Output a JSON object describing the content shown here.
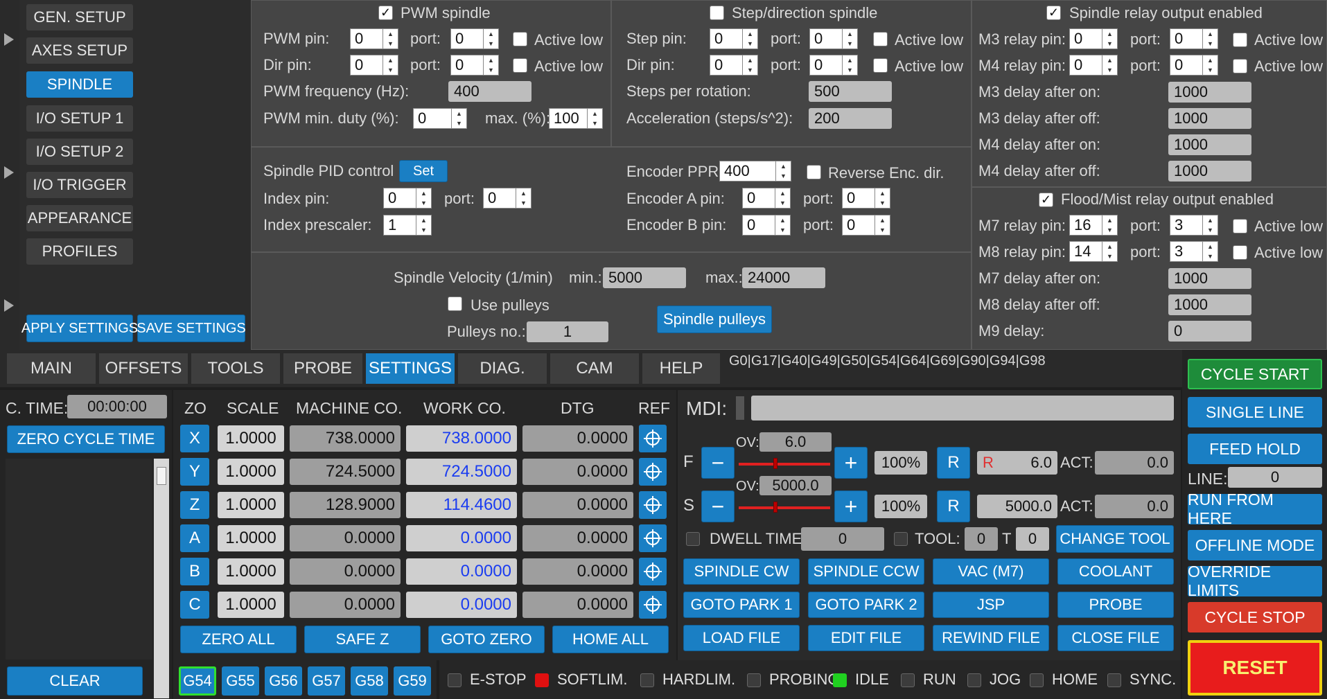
{
  "left_nav": {
    "items": [
      {
        "label": "GEN. SETUP",
        "active": false
      },
      {
        "label": "AXES SETUP",
        "active": false
      },
      {
        "label": "SPINDLE",
        "active": true
      },
      {
        "label": "I/O SETUP 1",
        "active": false
      },
      {
        "label": "I/O SETUP 2",
        "active": false
      },
      {
        "label": "I/O TRIGGER",
        "active": false
      },
      {
        "label": "APPEARANCE",
        "active": false
      },
      {
        "label": "PROFILES",
        "active": false
      }
    ],
    "apply_label": "APPLY SETTINGS",
    "save_label": "SAVE SETTINGS"
  },
  "pwm": {
    "title": "PWM spindle",
    "checked": true,
    "pwm_pin_label": "PWM pin:",
    "pwm_pin": "0",
    "port_label": "port:",
    "pwm_port": "0",
    "active_low": "Active low",
    "dir_pin_label": "Dir pin:",
    "dir_pin": "0",
    "dir_port": "0",
    "freq_label": "PWM frequency (Hz):",
    "freq": "400",
    "min_duty_label": "PWM min. duty (%):",
    "min_duty": "0",
    "max_label": "max. (%):",
    "max_duty": "100"
  },
  "step": {
    "title": "Step/direction spindle",
    "checked": false,
    "step_pin_label": "Step pin:",
    "step_pin": "0",
    "step_port": "0",
    "dir_pin_label": "Dir pin:",
    "dir_pin": "0",
    "dir_port": "0",
    "steps_label": "Steps per rotation:",
    "steps": "500",
    "accel_label": "Acceleration (steps/s^2):",
    "accel": "200"
  },
  "pid": {
    "label": "Spindle PID control",
    "set_label": "Set",
    "index_pin_label": "Index pin:",
    "index_pin": "0",
    "index_port": "0",
    "prescaler_label": "Index prescaler:",
    "prescaler": "1",
    "ppr_label": "Encoder PPR:",
    "ppr": "400",
    "reverse_label": "Reverse Enc. dir.",
    "enc_a_label": "Encoder A pin:",
    "enc_a_pin": "0",
    "enc_a_port": "0",
    "enc_b_label": "Encoder B pin:",
    "enc_b_pin": "0",
    "enc_b_port": "0"
  },
  "velocity": {
    "label": "Spindle Velocity (1/min)",
    "min_label": "min.:",
    "min": "5000",
    "max_label": "max.:",
    "max": "24000",
    "pulleys_label": "Use pulleys",
    "pulleys_no_label": "Pulleys no.:",
    "pulleys_no": "1",
    "pulleys_button": "Spindle pulleys"
  },
  "relay": {
    "title": "Spindle relay output enabled",
    "m3_pin_label": "M3 relay pin:",
    "m3_pin": "0",
    "m3_port": "0",
    "m4_pin_label": "M4 relay pin:",
    "m4_pin": "0",
    "m4_port": "0",
    "m3_on_label": "M3 delay after on:",
    "m3_on": "1000",
    "m3_off_label": "M3 delay after off:",
    "m3_off": "1000",
    "m4_on_label": "M4 delay after on:",
    "m4_on": "1000",
    "m4_off_label": "M4 delay after off:",
    "m4_off": "1000"
  },
  "flood": {
    "title": "Flood/Mist relay output enabled",
    "m7_pin_label": "M7 relay pin:",
    "m7_pin": "16",
    "m7_port": "3",
    "m8_pin_label": "M8 relay pin:",
    "m8_pin": "14",
    "m8_port": "3",
    "m7_on_label": "M7 delay after on:",
    "m7_on": "1000",
    "m8_off_label": "M8 delay after off:",
    "m8_off": "1000",
    "m9_label": "M9 delay:",
    "m9": "0"
  },
  "tabs": [
    "MAIN",
    "OFFSETS",
    "TOOLS",
    "PROBE",
    "SETTINGS",
    "DIAG.",
    "CAM",
    "HELP"
  ],
  "gcode_status": "G0|G17|G40|G49|G50|G54|G64|G69|G90|G94|G98",
  "cycle_time": {
    "label": "C. TIME:",
    "value": "00:00:00",
    "zero_label": "ZERO CYCLE TIME",
    "clear_label": "CLEAR"
  },
  "dro": {
    "headers": [
      "ZO",
      "SCALE",
      "MACHINE CO.",
      "WORK CO.",
      "DTG",
      "REF"
    ],
    "axes": [
      {
        "name": "X",
        "scale": "1.0000",
        "machine": "738.0000",
        "work": "738.0000",
        "dtg": "0.0000"
      },
      {
        "name": "Y",
        "scale": "1.0000",
        "machine": "724.5000",
        "work": "724.5000",
        "dtg": "0.0000"
      },
      {
        "name": "Z",
        "scale": "1.0000",
        "machine": "128.9000",
        "work": "114.4600",
        "dtg": "0.0000"
      },
      {
        "name": "A",
        "scale": "1.0000",
        "machine": "0.0000",
        "work": "0.0000",
        "dtg": "0.0000"
      },
      {
        "name": "B",
        "scale": "1.0000",
        "machine": "0.0000",
        "work": "0.0000",
        "dtg": "0.0000"
      },
      {
        "name": "C",
        "scale": "1.0000",
        "machine": "0.0000",
        "work": "0.0000",
        "dtg": "0.0000"
      }
    ],
    "zero_all": "ZERO ALL",
    "safe_z": "SAFE Z",
    "goto_zero": "GOTO ZERO",
    "home_all": "HOME ALL"
  },
  "wcs": [
    "G54",
    "G55",
    "G56",
    "G57",
    "G58",
    "G59"
  ],
  "mdi_label": "MDI:",
  "feed": {
    "label": "F",
    "ov_label": "OV:",
    "ov": "6.0",
    "percent": "100%",
    "r_label": "R",
    "value_prefix": "R",
    "value": "6.0",
    "act_label": "ACT:",
    "act": "0.0",
    "override_fraction": 0.4
  },
  "speed": {
    "label": "S",
    "ov_label": "OV:",
    "ov": "5000.0",
    "percent": "100%",
    "r_label": "R",
    "value": "5000.0",
    "act_label": "ACT:",
    "act": "0.0",
    "override_fraction": 0.4
  },
  "dwell": {
    "label": "DWELL TIME:",
    "value": "0",
    "tool_label": "TOOL:",
    "tool": "0",
    "t_label": "T",
    "t": "0",
    "change_tool": "CHANGE TOOL"
  },
  "macro_buttons": [
    [
      "SPINDLE CW",
      "SPINDLE CCW",
      "VAC (M7)",
      "COOLANT"
    ],
    [
      "GOTO PARK 1",
      "GOTO PARK 2",
      "JSP",
      "PROBE"
    ],
    [
      "LOAD FILE",
      "EDIT FILE",
      "REWIND FILE",
      "CLOSE FILE"
    ]
  ],
  "status_leds": [
    {
      "label": "E-STOP",
      "color": "#3c3c3c"
    },
    {
      "label": "SOFTLIM.",
      "color": "#e01010"
    },
    {
      "label": "HARDLIM.",
      "color": "#3c3c3c"
    },
    {
      "label": "PROBING",
      "color": "#3c3c3c"
    },
    {
      "label": "IDLE",
      "color": "#20d020"
    },
    {
      "label": "RUN",
      "color": "#3c3c3c"
    },
    {
      "label": "JOG",
      "color": "#3c3c3c"
    },
    {
      "label": "HOME",
      "color": "#3c3c3c"
    },
    {
      "label": "SYNC.",
      "color": "#3c3c3c"
    }
  ],
  "right_controls": {
    "cycle_start": "CYCLE START",
    "single_line": "SINGLE LINE",
    "feed_hold": "FEED HOLD",
    "line_label": "LINE:",
    "line": "0",
    "run_from_here": "RUN FROM HERE",
    "offline_mode": "OFFLINE MODE",
    "override_limits": "OVERRIDE LIMITS",
    "cycle_stop": "CYCLE STOP",
    "reset": "RESET"
  },
  "colors": {
    "accent": "#1a7fc4",
    "start": "#1e8c3a",
    "stop": "#d83a2a",
    "reset": "#e81c1c",
    "reset_border": "#f0d010",
    "active_wcs_border": "#30e030"
  }
}
